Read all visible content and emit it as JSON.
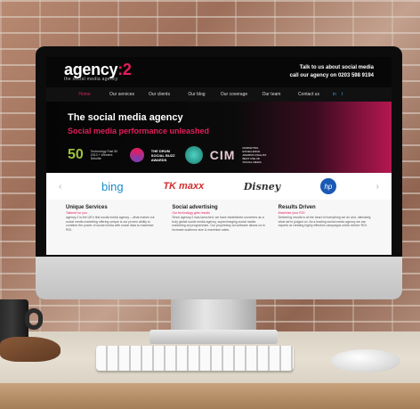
{
  "site": {
    "logo_main": "agency",
    "logo_accent": ":2",
    "tagline": "the social media agency",
    "contact_line1": "Talk to us about social media",
    "contact_line2": "call our agency on 0203 598 9194"
  },
  "nav": {
    "items": [
      "Home",
      "Our services",
      "Our clients",
      "Our blog",
      "Our coverage",
      "Our team",
      "Contact us"
    ],
    "active": "Home",
    "social": [
      "in",
      "t"
    ]
  },
  "hero": {
    "title": "The social media agency",
    "subtitle": "Social media performance unleashed"
  },
  "awards": {
    "fifty": "50",
    "fifty_text": "Technology Fast 50 2013 + Winners Deloitte",
    "buzz_text": "THE DRUM SOCIAL BUZZ AWARDS",
    "cim": "CIM",
    "cim_text": "MARKETING EXCELLENCE AWARDS FINALIST BEST USE OF SOCIAL MEDIA"
  },
  "clients": {
    "prev": "‹",
    "next": "›",
    "logos": [
      "bing",
      "TK maxx",
      "Disney",
      "hp"
    ]
  },
  "features": [
    {
      "title": "Unique Services",
      "subtitle": "Tailored for you",
      "body": "agency:2 is the UK's first social media agency – what makes our social media marketing offering unique is our proven ability to combine the power of social media with social data to maximise ROI."
    },
    {
      "title": "Social advertising",
      "subtitle": "Our technology gets results",
      "body": "Since agency:2 was launched, we have established ourselves as a truly global social media agency, supercharging social media marketing ad programmes. Our proprietary ad software allows us to increase audience size & maximise sales."
    },
    {
      "title": "Results Driven",
      "subtitle": "Maximise your ROI",
      "body": "Delivering results is at the heart of everything we do and, ultimately, what we're judged on. As a leading social media agency we are experts at creating highly effective campaigns which deliver ROI."
    }
  ]
}
